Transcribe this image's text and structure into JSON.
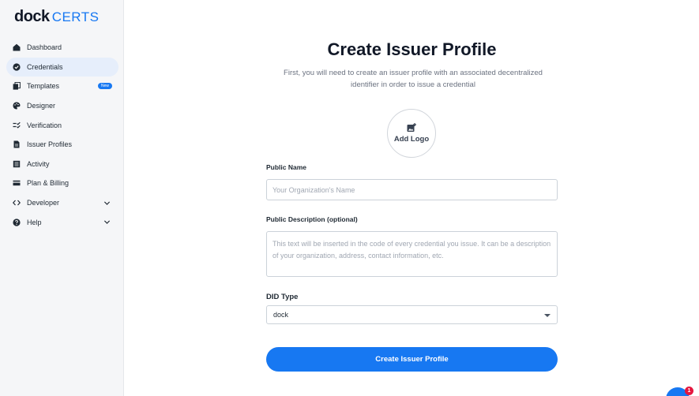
{
  "brand": {
    "dock": "dock",
    "certs": "CERTS"
  },
  "sidebar": {
    "items": [
      {
        "label": "Dashboard",
        "icon": "home-icon"
      },
      {
        "label": "Credentials",
        "icon": "verified-check-icon",
        "active": true
      },
      {
        "label": "Templates",
        "icon": "copy-icon",
        "badge": "New"
      },
      {
        "label": "Designer",
        "icon": "palette-icon"
      },
      {
        "label": "Verification",
        "icon": "checklist-icon"
      },
      {
        "label": "Issuer Profiles",
        "icon": "document-icon"
      },
      {
        "label": "Activity",
        "icon": "list-icon"
      },
      {
        "label": "Plan & Billing",
        "icon": "credit-card-icon"
      },
      {
        "label": "Developer",
        "icon": "code-icon",
        "expandable": true
      },
      {
        "label": "Help",
        "icon": "help-icon",
        "expandable": true
      }
    ]
  },
  "form": {
    "title": "Create Issuer Profile",
    "subtitle": "First, you will need to create an issuer profile with an associated decentralized identifier in order to issue a credential",
    "add_logo": "Add Logo",
    "public_name_label": "Public Name",
    "public_name_placeholder": "Your Organization's Name",
    "description_label": "Public Description (optional)",
    "description_placeholder": "This text will be inserted in the code of every credential you issue. It can be a description of your organization, address, contact information, etc.",
    "did_type_label": "DID Type",
    "did_type_value": "dock",
    "submit_label": "Create Issuer Profile"
  },
  "chat": {
    "badge_count": "1"
  },
  "colors": {
    "accent": "#1778f2",
    "sidebar_bg": "#f5f6f8",
    "active_bg": "#e6eefb",
    "notification": "#e5173f"
  }
}
